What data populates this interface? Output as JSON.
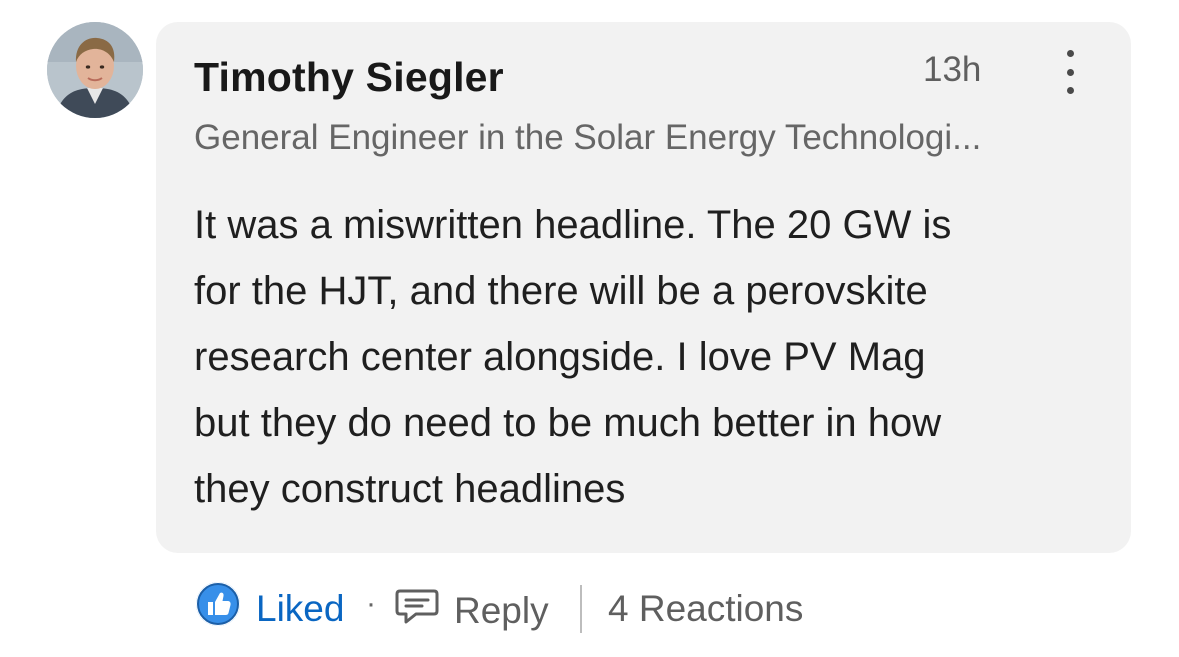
{
  "comment": {
    "author": "Timothy Siegler",
    "headline": "General Engineer in the Solar Energy Technologi...",
    "time": "13h",
    "text": "It was a miswritten headline. The 20 GW is\nfor the HJT, and there will be a perovskite\nresearch center alongside. I love PV Mag\nbut they do need to be much better in how\nthey construct headlines"
  },
  "actions": {
    "liked_label": "Liked",
    "separator": "·",
    "reply_label": "Reply",
    "reactions_label": "4 Reactions"
  },
  "icons": {
    "avatar": "profile-photo",
    "more": "more-vertical-icon",
    "liked": "thumbs-up-icon",
    "reply": "speech-bubble-icon"
  },
  "colors": {
    "bubble_bg": "#f2f2f2",
    "liked_blue": "#0a66c2",
    "like_icon_blue": "#378fe9",
    "muted_text": "#5f5f5f"
  }
}
